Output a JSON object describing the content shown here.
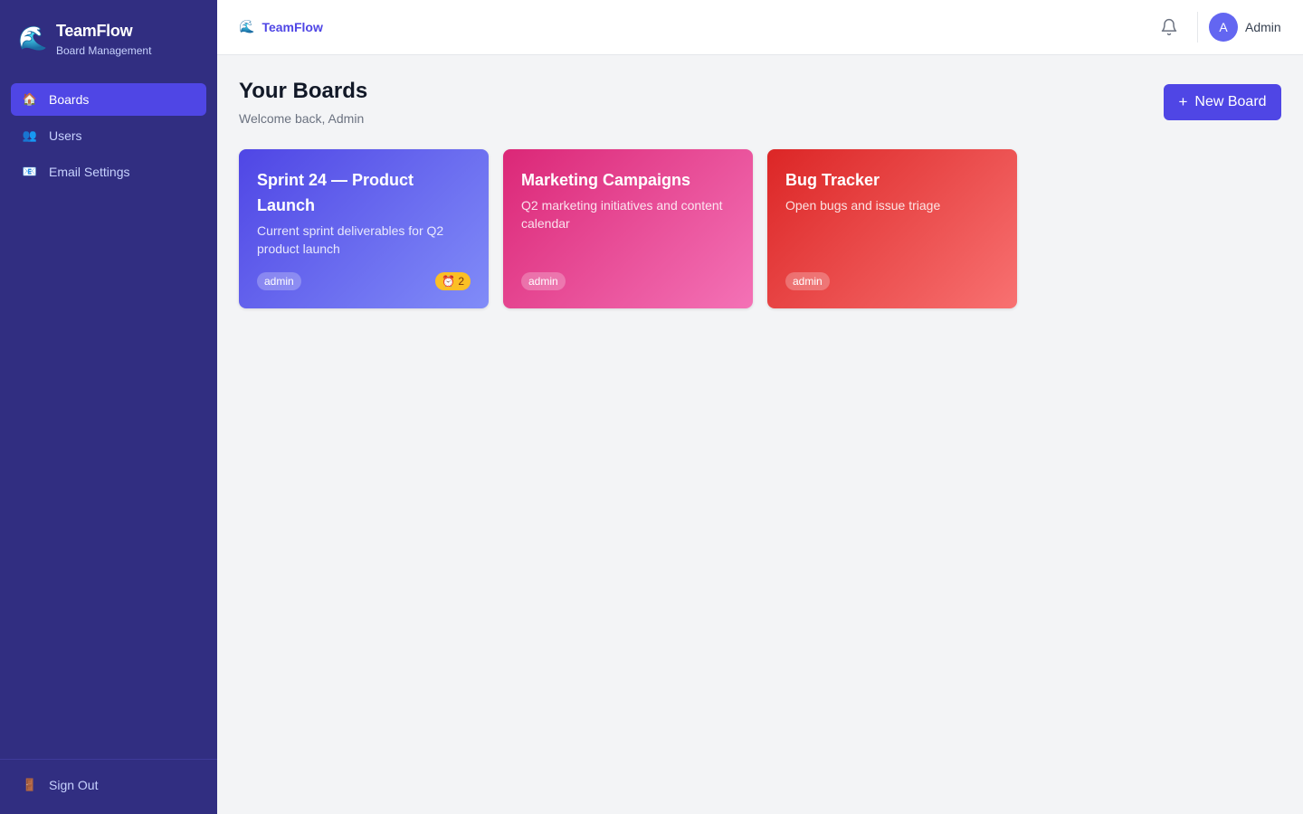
{
  "app": {
    "brand_emoji": "🌊",
    "name": "TeamFlow",
    "subtitle": "Board Management"
  },
  "sidebar": {
    "items": [
      {
        "icon": "🏠",
        "icon_name": "home-icon",
        "label": "Boards",
        "active": true
      },
      {
        "icon": "👥",
        "icon_name": "users-icon",
        "label": "Users",
        "active": false
      },
      {
        "icon": "📧",
        "icon_name": "email-icon",
        "label": "Email Settings",
        "active": false
      }
    ],
    "sign_out": {
      "icon": "🚪",
      "icon_name": "door-icon",
      "label": "Sign Out"
    }
  },
  "topbar": {
    "brand_emoji": "🌊",
    "brand": "TeamFlow",
    "notification_icon": "bell-icon",
    "user": {
      "initial": "A",
      "name": "Admin"
    }
  },
  "main": {
    "title": "Your Boards",
    "subtitle": "Welcome back, Admin",
    "new_board_icon": "+",
    "new_board_label": "New Board"
  },
  "boards": [
    {
      "title": "Sprint 24 — Product Launch",
      "description": "Current sprint deliverables for Q2 product launch",
      "tag": "admin",
      "due_icon": "⏰",
      "due_count": "2",
      "gradient": [
        "#4f46e5",
        "#818cf8"
      ]
    },
    {
      "title": "Marketing Campaigns",
      "description": "Q2 marketing initiatives and content calendar",
      "tag": "admin",
      "gradient": [
        "#db2777",
        "#f472b6"
      ]
    },
    {
      "title": "Bug Tracker",
      "description": "Open bugs and issue triage",
      "tag": "admin",
      "gradient": [
        "#dc2626",
        "#f87171"
      ]
    }
  ],
  "colors": {
    "sidebar_bg": "#312e81",
    "accent": "#4f46e5",
    "page_bg": "#f3f4f6"
  }
}
